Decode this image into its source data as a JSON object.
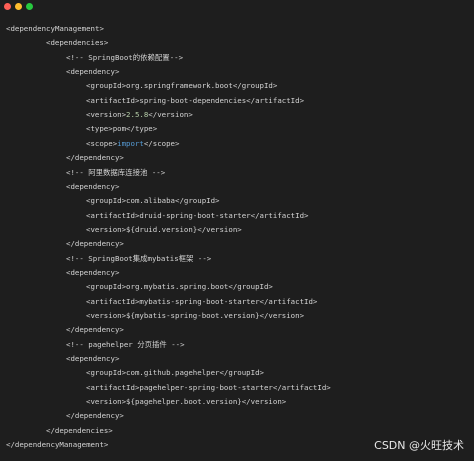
{
  "window": {
    "controls": [
      "close",
      "minimize",
      "maximize"
    ]
  },
  "code": {
    "lines": [
      {
        "indent": 0,
        "text": "<dependencyManagement>"
      },
      {
        "indent": 1,
        "text": "<dependencies>"
      },
      {
        "indent": 2,
        "text": "<!-- SpringBoot的依赖配置-->"
      },
      {
        "indent": 2,
        "text": "<dependency>"
      },
      {
        "indent": 3,
        "text": "<groupId>org.springframework.boot</groupId>"
      },
      {
        "indent": 3,
        "text": "<artifactId>spring-boot-dependencies</artifactId>"
      },
      {
        "indent": 3,
        "text_parts": [
          "<version>",
          "2.5.8",
          "</version>"
        ],
        "highlight_index": 1,
        "highlight_kind": "num"
      },
      {
        "indent": 3,
        "text": "<type>pom</type>"
      },
      {
        "indent": 3,
        "text_parts": [
          "<scope>",
          "import",
          "</scope>"
        ],
        "highlight_index": 1,
        "highlight_kind": "kw"
      },
      {
        "indent": 2,
        "text": "</dependency>"
      },
      {
        "indent": 2,
        "text": "<!-- 阿里数据库连接池 -->"
      },
      {
        "indent": 2,
        "text": "<dependency>"
      },
      {
        "indent": 3,
        "text": "<groupId>com.alibaba</groupId>"
      },
      {
        "indent": 3,
        "text": "<artifactId>druid-spring-boot-starter</artifactId>"
      },
      {
        "indent": 3,
        "text": "<version>${druid.version}</version>"
      },
      {
        "indent": 2,
        "text": "</dependency>"
      },
      {
        "indent": 2,
        "text": "<!-- SpringBoot集成mybatis框架 -->"
      },
      {
        "indent": 2,
        "text": "<dependency>"
      },
      {
        "indent": 3,
        "text": "<groupId>org.mybatis.spring.boot</groupId>"
      },
      {
        "indent": 3,
        "text": "<artifactId>mybatis-spring-boot-starter</artifactId>"
      },
      {
        "indent": 3,
        "text": "<version>${mybatis-spring-boot.version}</version>"
      },
      {
        "indent": 2,
        "text": "</dependency>"
      },
      {
        "indent": 2,
        "text": "<!-- pagehelper 分页插件 -->"
      },
      {
        "indent": 2,
        "text": "<dependency>"
      },
      {
        "indent": 3,
        "text": "<groupId>com.github.pagehelper</groupId>"
      },
      {
        "indent": 3,
        "text": "<artifactId>pagehelper-spring-boot-starter</artifactId>"
      },
      {
        "indent": 3,
        "text": "<version>${pagehelper.boot.version}</version>"
      },
      {
        "indent": 2,
        "text": "</dependency>"
      },
      {
        "indent": 1,
        "text": "</dependencies>"
      },
      {
        "indent": 0,
        "text": "</dependencyManagement>"
      }
    ]
  },
  "watermark": {
    "text": "CSDN @火旺技术"
  }
}
